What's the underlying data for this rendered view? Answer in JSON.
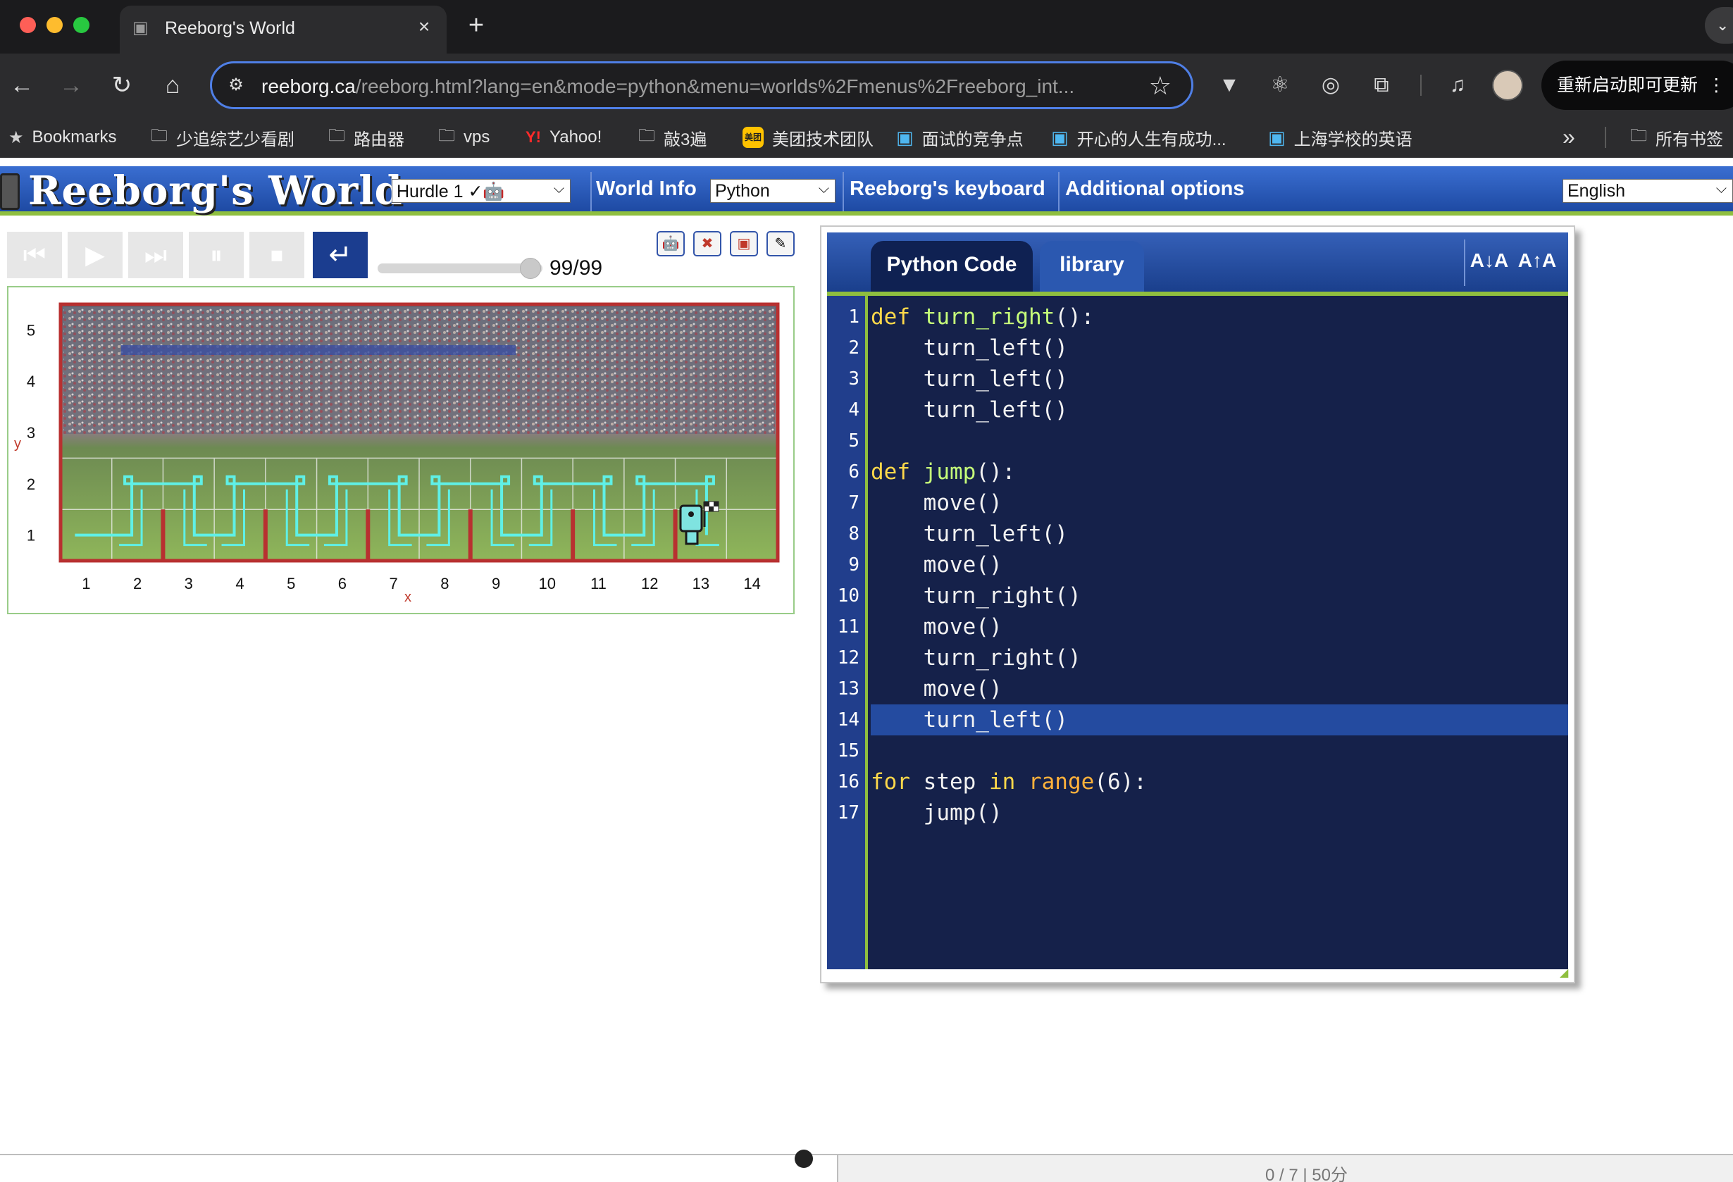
{
  "browser": {
    "tab_title": "Reeborg's World",
    "tab_close": "×",
    "new_tab": "+",
    "url_host": "reeborg.ca",
    "url_path": "/reeborg.html?lang=en&mode=python&menu=worlds%2Fmenus%2Freeborg_int...",
    "update_button": "重新启动即可更新",
    "more_menu": "⋮",
    "bookmarks": [
      {
        "label": "Bookmarks",
        "icon": "star-icon"
      },
      {
        "label": "少追综艺少看剧",
        "icon": "folder-icon"
      },
      {
        "label": "路由器",
        "icon": "folder-icon"
      },
      {
        "label": "vps",
        "icon": "folder-icon"
      },
      {
        "label": "Yahoo!",
        "icon": "yahoo-icon"
      },
      {
        "label": "敲3遍",
        "icon": "folder-icon"
      },
      {
        "label": "美团技术团队",
        "icon": "meituan-icon"
      },
      {
        "label": "面试的竞争点",
        "icon": "bilibili-icon"
      },
      {
        "label": "开心的人生有成功...",
        "icon": "bilibili-icon"
      },
      {
        "label": "上海学校的英语",
        "icon": "bilibili-icon"
      }
    ],
    "bookmarks_more": "»",
    "all_bookmarks": "所有书签"
  },
  "header": {
    "logo": "Reeborg's World",
    "world_select": "Hurdle 1 ✓🤖",
    "world_info": "World Info",
    "language_select": "Python",
    "keyboard": "Reeborg's keyboard",
    "additional_options": "Additional options",
    "ui_language": "English"
  },
  "controls": {
    "step_count": "99/99",
    "slider_fraction": 1.0
  },
  "world": {
    "y_axis_label": "y",
    "x_axis_label": "x",
    "y_ticks": [
      "1",
      "2",
      "3",
      "4",
      "5"
    ],
    "x_ticks": [
      "1",
      "2",
      "3",
      "4",
      "5",
      "6",
      "7",
      "8",
      "9",
      "10",
      "11",
      "12",
      "13",
      "14"
    ],
    "colors": {
      "border": "#b83030",
      "wall": "#b83030",
      "trace": "#5ff0e6",
      "axis_label": "#c0392b"
    }
  },
  "editor": {
    "tabs": [
      "Python Code",
      "library"
    ],
    "font_decrease": "A↓A",
    "font_increase": "A↑A",
    "highlighted_line": 14,
    "line_numbers": [
      "1",
      "2",
      "3",
      "4",
      "5",
      "6",
      "7",
      "8",
      "9",
      "10",
      "11",
      "12",
      "13",
      "14",
      "15",
      "16",
      "17"
    ]
  },
  "bottom_bar": {
    "status": "0 / 7 | 50分"
  }
}
